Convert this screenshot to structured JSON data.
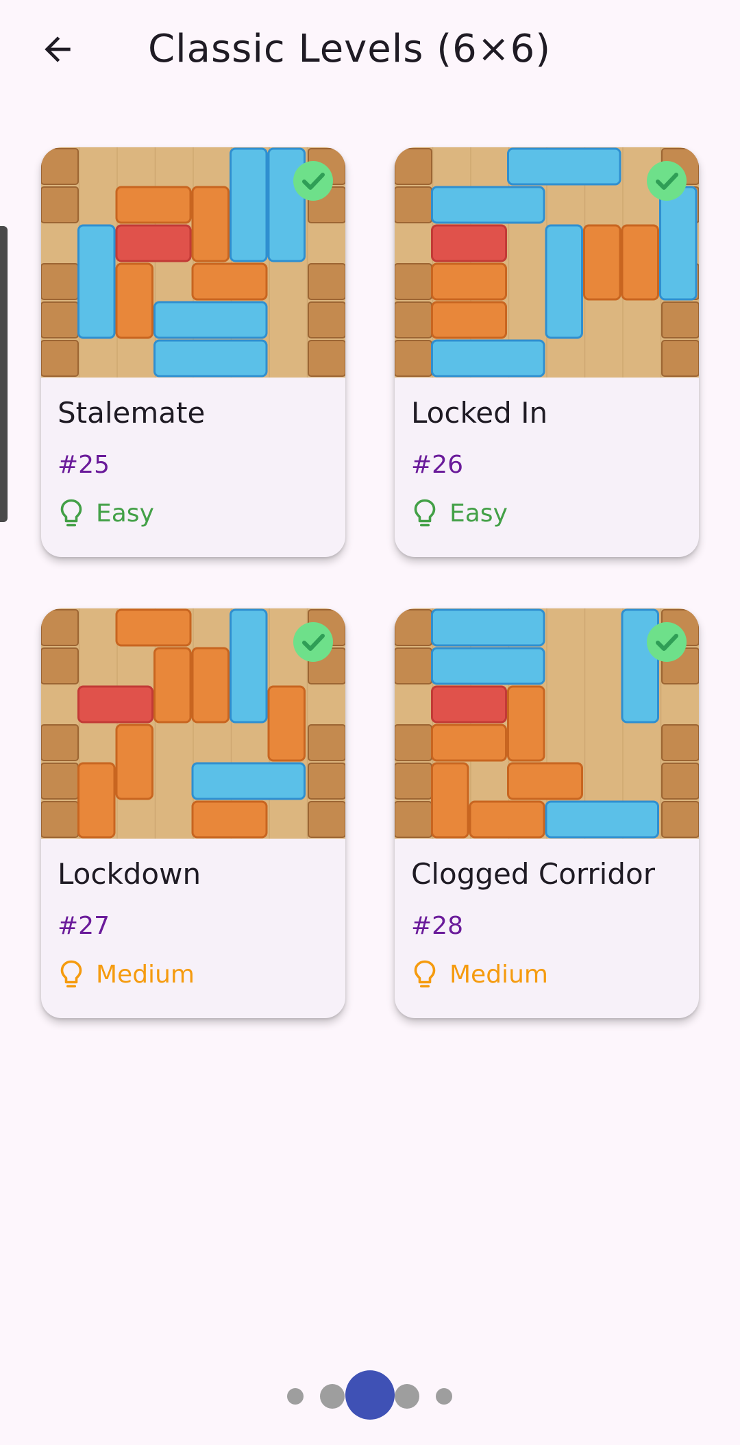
{
  "header": {
    "title": "Classic Levels (6×6)",
    "back_icon": "arrow-left-icon"
  },
  "colors": {
    "background": "#fdf6fc",
    "easy": "#43a047",
    "medium": "#f59b0f",
    "level_number": "#6a1b9a",
    "completed_check": "#6ee08a",
    "pager_active": "#3f51b5",
    "pager_inactive": "#9e9e9e"
  },
  "levels": [
    {
      "name": "Stalemate",
      "number": "#25",
      "difficulty": "Easy",
      "completed": true
    },
    {
      "name": "Locked In",
      "number": "#26",
      "difficulty": "Easy",
      "completed": true
    },
    {
      "name": "Lockdown",
      "number": "#27",
      "difficulty": "Medium",
      "completed": true
    },
    {
      "name": "Clogged Corridor",
      "number": "#28",
      "difficulty": "Medium",
      "completed": true
    }
  ],
  "pager": {
    "page_count": 5,
    "active_index": 2
  }
}
